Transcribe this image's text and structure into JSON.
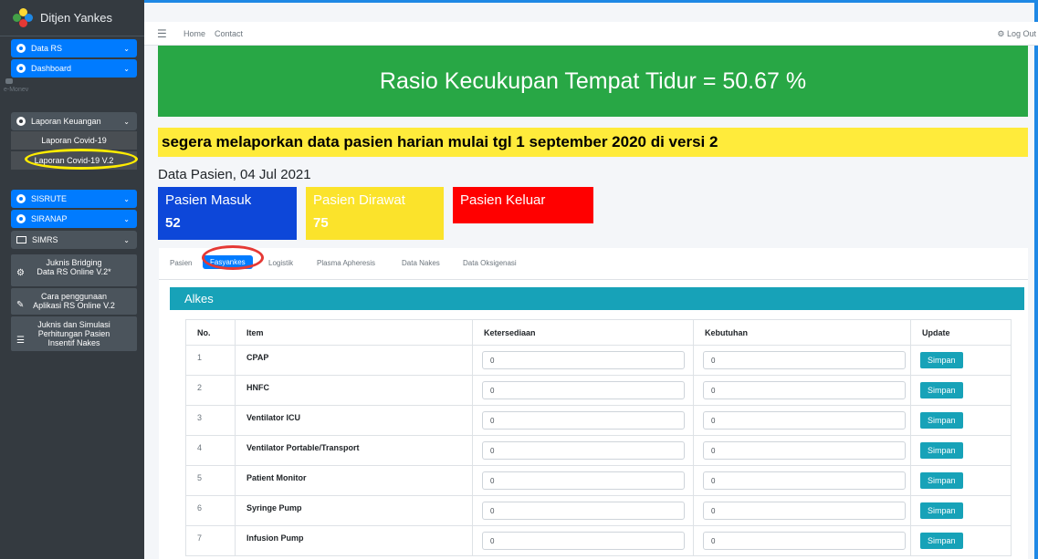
{
  "sidebar": {
    "brand": "Ditjen Yankes",
    "items": {
      "data_rs": "Data RS",
      "dashboard": "Dashboard",
      "emonev": "e-Monev",
      "laporan_keuangan": "Laporan Keuangan",
      "laporan_covid": "Laporan Covid-19",
      "laporan_covid_v2": "Laporan Covid-19 V.2",
      "sisrute": "SISRUTE",
      "siranap": "SIRANAP",
      "simrs": "SIMRS",
      "juknis_bridging_1": "Juknis Bridging",
      "juknis_bridging_2": "Data RS Online V.2*",
      "cara_1": "Cara penggunaan",
      "cara_2": "Aplikasi RS Online V.2",
      "juknis_sim_1": "Juknis dan Simulasi",
      "juknis_sim_2": "Perhitungan Pasien",
      "juknis_sim_3": "Insentif Nakes"
    }
  },
  "topnav": {
    "home": "Home",
    "contact": "Contact",
    "logout": "Log Out"
  },
  "banner": "Rasio Kecukupan Tempat Tidur = 50.67 %",
  "notice": "segera melaporkan data pasien harian mulai tgl 1 september 2020 di versi 2",
  "date_title": "Data Pasien, 04 Jul 2021",
  "stats": {
    "masuk": {
      "label": "Pasien Masuk",
      "value": "52",
      "color": "#0d47d9"
    },
    "dirawat": {
      "label": "Pasien Dirawat",
      "value": "75",
      "color": "#fbe32b"
    },
    "keluar": {
      "label": "Pasien Keluar",
      "value": "",
      "color": "#ff0000"
    }
  },
  "tabs": [
    "Pasien",
    "Fasyankes",
    "Logistik",
    "Plasma Apheresis",
    "Data Nakes",
    "Data Oksigenasi"
  ],
  "card_title": "Alkes",
  "table": {
    "headers": [
      "No.",
      "Item",
      "Ketersediaan",
      "Kebutuhan",
      "Update"
    ],
    "rows": [
      {
        "no": "1",
        "item": "CPAP",
        "ketersediaan": "0",
        "kebutuhan": "0"
      },
      {
        "no": "2",
        "item": "HNFC",
        "ketersediaan": "0",
        "kebutuhan": "0"
      },
      {
        "no": "3",
        "item": "Ventilator ICU",
        "ketersediaan": "0",
        "kebutuhan": "0"
      },
      {
        "no": "4",
        "item": "Ventilator Portable/Transport",
        "ketersediaan": "0",
        "kebutuhan": "0"
      },
      {
        "no": "5",
        "item": "Patient Monitor",
        "ketersediaan": "0",
        "kebutuhan": "0"
      },
      {
        "no": "6",
        "item": "Syringe Pump",
        "ketersediaan": "0",
        "kebutuhan": "0"
      },
      {
        "no": "7",
        "item": "Infusion Pump",
        "ketersediaan": "0",
        "kebutuhan": "0"
      }
    ],
    "button_label": "Simpan"
  }
}
